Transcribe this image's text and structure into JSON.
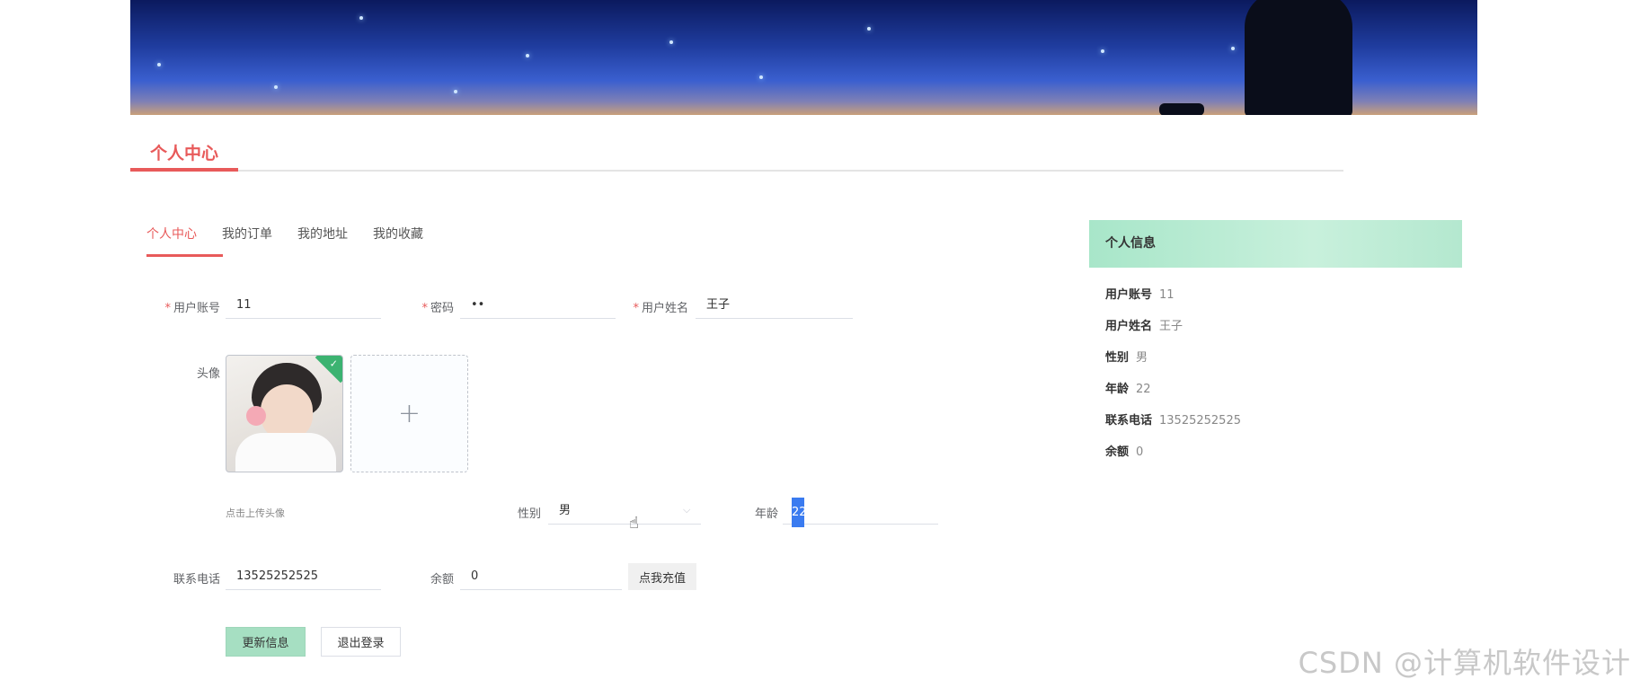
{
  "section": {
    "title": "个人中心"
  },
  "tabs": [
    {
      "label": "个人中心"
    },
    {
      "label": "我的订单"
    },
    {
      "label": "我的地址"
    },
    {
      "label": "我的收藏"
    }
  ],
  "form": {
    "username_label": "用户账号",
    "username_value": "11",
    "password_label": "密码",
    "password_value": "••",
    "realname_label": "用户姓名",
    "realname_value": "王子",
    "avatar_label": "头像",
    "upload_plus": "+",
    "upload_hint": "点击上传头像",
    "gender_label": "性别",
    "gender_value": "男",
    "age_label": "年龄",
    "age_value": "22",
    "phone_label": "联系电话",
    "phone_value": "13525252525",
    "balance_label": "余额",
    "balance_value": "0",
    "recharge_button": "点我充值",
    "update_button": "更新信息",
    "logout_button": "退出登录"
  },
  "info": {
    "header": "个人信息",
    "rows": [
      {
        "key": "用户账号",
        "value": "11"
      },
      {
        "key": "用户姓名",
        "value": "王子"
      },
      {
        "key": "性别",
        "value": "男"
      },
      {
        "key": "年龄",
        "value": "22"
      },
      {
        "key": "联系电话",
        "value": "13525252525"
      },
      {
        "key": "余额",
        "value": "0"
      }
    ]
  },
  "watermark": "CSDN @计算机软件设计",
  "colors": {
    "accent": "#e85a5a",
    "panel_green": "#a8e6c9",
    "update_button": "#a6dfc2"
  },
  "icons": {
    "avatar_status": "check-icon",
    "upload": "plus-icon",
    "select": "chevron-down-icon",
    "cursor": "hand-cursor-icon"
  }
}
